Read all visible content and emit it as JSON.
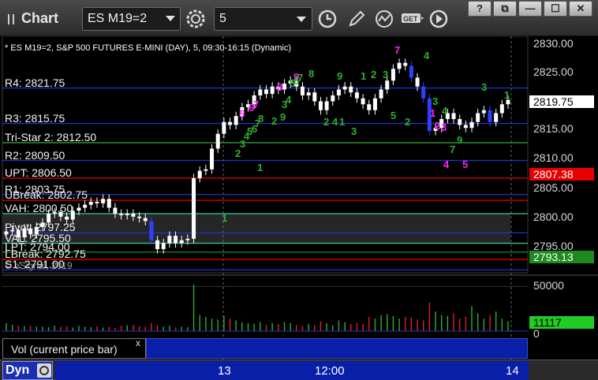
{
  "window": {
    "title": "Chart",
    "symbol": "ES M19=2",
    "interval": "5"
  },
  "toolbar_icons": [
    "settings-gear-icon",
    "clock-icon",
    "pencil-icon",
    "study-icon",
    "get-icon",
    "play-icon"
  ],
  "window_buttons": {
    "help": "?",
    "restore": "⧉",
    "minimize": "—",
    "maximize": "☐",
    "close": "✕"
  },
  "chart": {
    "subtitle": "* ES M19=2, S&P 500 FUTURES E-MINI (DAY), 5, 09:30-16:15 (Dynamic)",
    "copyright": "© eSignal, 2019",
    "price_ticks": [
      "2830.00",
      "2825.00",
      "2820.00",
      "2815.00",
      "2810.00",
      "2805.00",
      "2800.00",
      "2795.00"
    ],
    "price_tags": [
      {
        "label": "2819.75",
        "bg": "#ffffff",
        "fg": "#000000"
      },
      {
        "label": "2807.38",
        "bg": "#e60000",
        "fg": "#ffffff"
      },
      {
        "label": "2793.13",
        "bg": "#1e8a1e",
        "fg": "#ffffff"
      }
    ],
    "levels": [
      {
        "label": "R4: 2821.75",
        "price": 2821.75,
        "color": "#2233cc"
      },
      {
        "label": "R3: 2815.75",
        "price": 2815.75,
        "color": "#2233cc"
      },
      {
        "label": "Tri-Star 2: 2812.50",
        "price": 2812.5,
        "color": "#39a839"
      },
      {
        "label": "R2: 2809.50",
        "price": 2809.5,
        "color": "#2233cc"
      },
      {
        "label": "UPT: 2806.50",
        "price": 2806.5,
        "color": "#e60000"
      },
      {
        "label": "R1: 2803.75",
        "price": 2803.75,
        "color": "#2233cc"
      },
      {
        "label": "UBreak: 2802.75",
        "price": 2802.75,
        "color": "#e60000"
      },
      {
        "label": "VAH: 2800.50",
        "price": 2800.5,
        "color": "#39c8a8"
      },
      {
        "label": "Pivot: 2797.25",
        "price": 2797.25,
        "color": "#2233cc"
      },
      {
        "label": "VAL: 2795.50",
        "price": 2795.5,
        "color": "#39c8a8"
      },
      {
        "label": "LPT: 2794.00",
        "price": 2794.0,
        "color": "#1e8a1e"
      },
      {
        "label": "LBreak: 2792.75",
        "price": 2792.75,
        "color": "#e60000"
      },
      {
        "label": "S1: 2791.00",
        "price": 2791.0,
        "color": "#2233cc"
      }
    ],
    "seq_marks": [
      {
        "t": "5",
        "c": "m"
      },
      {
        "t": "6",
        "c": "m"
      },
      {
        "t": "7",
        "c": "m"
      },
      {
        "t": "8",
        "c": "m"
      },
      {
        "t": "9",
        "c": "m"
      },
      {
        "t": "7",
        "c": "m"
      },
      {
        "t": "1",
        "c": "m"
      },
      {
        "t": "2",
        "c": "m"
      },
      {
        "t": "3",
        "c": "m"
      },
      {
        "t": "4",
        "c": "m"
      },
      {
        "t": "5",
        "c": "m"
      },
      {
        "t": "1",
        "c": "g"
      },
      {
        "t": "2",
        "c": "g"
      },
      {
        "t": "3",
        "c": "g"
      },
      {
        "t": "4",
        "c": "g"
      },
      {
        "t": "5",
        "c": "g"
      },
      {
        "t": "6",
        "c": "g"
      },
      {
        "t": "7",
        "c": "g"
      },
      {
        "t": "8",
        "c": "g"
      },
      {
        "t": "9",
        "c": "g"
      },
      {
        "t": "1",
        "c": "g"
      },
      {
        "t": "2",
        "c": "g"
      },
      {
        "t": "3",
        "c": "g"
      },
      {
        "t": "4",
        "c": "g"
      },
      {
        "t": "5",
        "c": "g"
      },
      {
        "t": "6",
        "c": "g"
      },
      {
        "t": "7",
        "c": "g"
      },
      {
        "t": "8",
        "c": "g"
      },
      {
        "t": "9",
        "c": "g"
      },
      {
        "t": "1",
        "c": "g"
      },
      {
        "t": "2",
        "c": "g"
      },
      {
        "t": "3",
        "c": "g"
      },
      {
        "t": "4",
        "c": "g"
      },
      {
        "t": "1",
        "c": "g"
      },
      {
        "t": "2",
        "c": "g"
      },
      {
        "t": "3",
        "c": "g"
      },
      {
        "t": "4",
        "c": "g"
      },
      {
        "t": "5",
        "c": "g"
      },
      {
        "t": "2",
        "c": "g"
      },
      {
        "t": "3",
        "c": "g"
      },
      {
        "t": "4",
        "c": "g"
      },
      {
        "t": "7",
        "c": "g"
      },
      {
        "t": "9",
        "c": "g"
      },
      {
        "t": "3",
        "c": "g"
      },
      {
        "t": "1",
        "c": "g"
      }
    ]
  },
  "volume": {
    "ticks": [
      "50000",
      "0"
    ],
    "current": "11117",
    "panel_label": "Vol (current price bar)",
    "close_glyph": "x"
  },
  "time_axis": {
    "labels": [
      "13",
      "12:00",
      "14"
    ]
  },
  "bottom": {
    "dyn_label": "Dyn"
  },
  "chart_data": {
    "type": "candlestick",
    "ylim": [
      2790.5,
      2830.5
    ],
    "volume_ylim": [
      0,
      60000
    ],
    "x_labels": [
      "13",
      "12:00",
      "14"
    ],
    "close_series": [
      2797.5,
      2797.75,
      2796.5,
      2798.0,
      2797.0,
      2798.25,
      2799.0,
      2800.5,
      2800.75,
      2800.0,
      2799.5,
      2801.0,
      2801.5,
      2802.0,
      2802.5,
      2802.25,
      2803.0,
      2801.5,
      2800.5,
      2800.25,
      2800.5,
      2800.0,
      2799.75,
      2799.25,
      2796.0,
      2794.5,
      2795.5,
      2796.75,
      2795.5,
      2796.0,
      2796.25,
      2806.5,
      2807.75,
      2808.0,
      2811.5,
      2814.0,
      2816.0,
      2815.5,
      2817.0,
      2818.5,
      2819.0,
      2820.5,
      2821.5,
      2820.75,
      2822.0,
      2821.5,
      2822.5,
      2823.0,
      2822.0,
      2820.5,
      2821.0,
      2819.5,
      2818.0,
      2819.5,
      2820.5,
      2821.5,
      2822.0,
      2821.0,
      2820.0,
      2819.0,
      2818.0,
      2820.0,
      2821.5,
      2823.0,
      2825.0,
      2826.0,
      2825.5,
      2823.5,
      2822.0,
      2820.0,
      2814.5,
      2815.0,
      2816.5,
      2817.5,
      2816.5,
      2815.5,
      2815.0,
      2816.0,
      2817.5,
      2818.0,
      2816.0,
      2817.5,
      2819.0,
      2819.75
    ],
    "volume_series": [
      9000,
      7000,
      6000,
      5500,
      6000,
      5000,
      5000,
      4500,
      6000,
      5000,
      5500,
      4000,
      6000,
      5000,
      4500,
      5500,
      4000,
      5000,
      3500,
      6000,
      6500,
      7000,
      5500,
      5000,
      9000,
      6500,
      5000,
      6000,
      4000,
      5000,
      4500,
      52000,
      18000,
      16000,
      14000,
      13000,
      17000,
      14000,
      12000,
      10000,
      9000,
      8000,
      10000,
      7000,
      9000,
      8000,
      10000,
      9000,
      7000,
      6000,
      8000,
      7000,
      11000,
      9000,
      6500,
      12000,
      10000,
      8000,
      9000,
      8000,
      16000,
      14000,
      18000,
      19000,
      17000,
      14000,
      16000,
      15000,
      13000,
      12000,
      32000,
      22000,
      18000,
      17000,
      20000,
      14000,
      16000,
      28000,
      20000,
      14000,
      18000,
      22000,
      14000,
      11117
    ]
  }
}
